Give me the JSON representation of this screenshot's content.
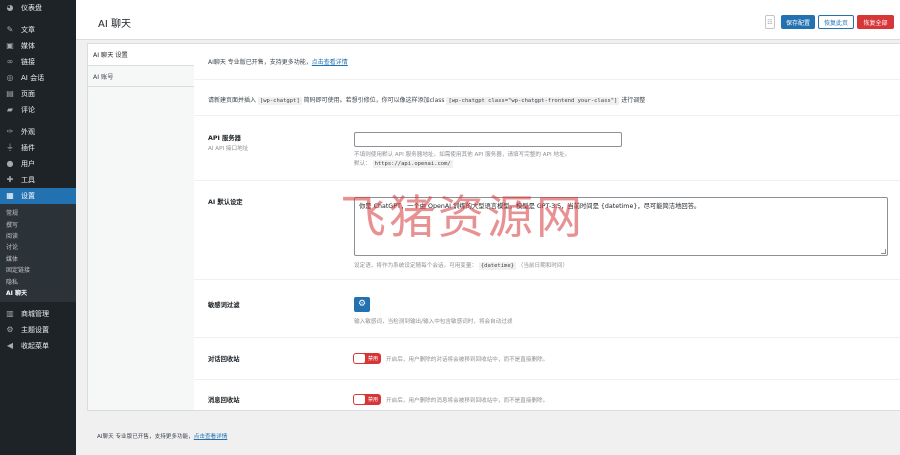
{
  "menu": {
    "items": [
      {
        "label": "仪表盘",
        "icon": "dashboard-icon"
      },
      {
        "label": "文章",
        "icon": "pin-icon"
      },
      {
        "label": "媒体",
        "icon": "media-icon"
      },
      {
        "label": "链接",
        "icon": "link-icon"
      },
      {
        "label": "AI 会话",
        "icon": "ai-chat-icon"
      },
      {
        "label": "页面",
        "icon": "page-icon"
      },
      {
        "label": "评论",
        "icon": "comment-icon"
      },
      {
        "label": "外观",
        "icon": "brush-icon"
      },
      {
        "label": "插件",
        "icon": "plugin-icon"
      },
      {
        "label": "用户",
        "icon": "user-icon"
      },
      {
        "label": "工具",
        "icon": "wrench-icon"
      },
      {
        "label": "设置",
        "icon": "settings-icon"
      }
    ],
    "settings_sub": [
      "常规",
      "撰写",
      "阅读",
      "讨论",
      "媒体",
      "固定链接",
      "隐私",
      "AI 聊天"
    ],
    "bottom_items": [
      {
        "label": "商城管理",
        "icon": "shop-icon"
      },
      {
        "label": "主题设置",
        "icon": "gear-icon"
      },
      {
        "label": "收起菜单",
        "icon": "collapse-icon"
      }
    ]
  },
  "header": {
    "title": "AI 聊天",
    "btn_save": "保存配置",
    "btn_restore_page": "恢复此页",
    "btn_restore_all": "恢复全部"
  },
  "tabs": [
    "AI 聊天 设置",
    "AI 账号"
  ],
  "settings": {
    "promo_text": "AI聊天 专业版已开售，支持更多功能，",
    "promo_link": "点击查看详情",
    "usage_prefix": "请新建页面并插入",
    "usage_code1": "[wp-chatgpt]",
    "usage_mid": "简码即可使用。若想引修位，你可以像这样添加class",
    "usage_code2": "[wp-chatgpt class=\"wp-chatgpt-frontend your-class\"]",
    "usage_suffix": "进行调整",
    "api_label": "API 服务器",
    "api_sub": "AI API 接口地址",
    "api_value": "",
    "api_desc1": "不填则使用默认 API 服务器地址。如需使用其他 API 服务器，请填写完整的 API 地址。",
    "api_desc2_prefix": "默认：",
    "api_desc2_code": "https://api.openai.com/",
    "prompt_label": "AI 默认设定",
    "prompt_value": "你是 ChatGPT，一个由 OpenAI 训练的大型语言模型。模型是 GPT-3.5，当前时间是 {datetime}，尽可能简洁地回答。",
    "prompt_desc_prefix": "设定语，将作为系统设定随每个会话。可用变量：",
    "prompt_desc_code": "{datetime}",
    "prompt_desc_suffix": "（当前日期和时间）",
    "sensitive_label": "敏感词过滤",
    "sensitive_desc": "输入敏感词，当检测到输出/输入中包含敏感词时，将会自动过滤",
    "chat_recycle_label": "对话回收站",
    "chat_recycle_toggle": "禁用",
    "chat_recycle_desc": "开启后，用户删除的对话将会被移到回收站中，而不是直接删除。",
    "msg_recycle_label": "消息回收站",
    "msg_recycle_toggle": "禁用",
    "msg_recycle_desc": "开启后，用户删除的消息将会被移到回收站中，而不是直接删除。"
  },
  "footer": {
    "text": "AI聊天 专业版已开售，支持更多功能，",
    "link": "点击查看详情"
  },
  "watermark": "飞猪资源网",
  "colors": {
    "accent": "#2271b1",
    "danger": "#d63638",
    "sidebar": "#1d2327"
  }
}
